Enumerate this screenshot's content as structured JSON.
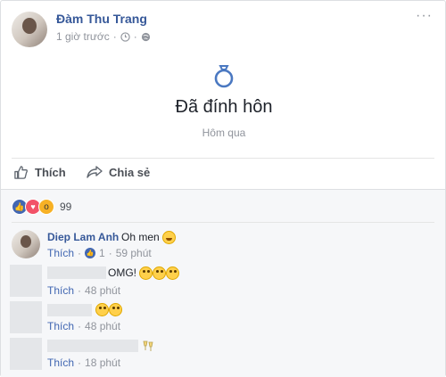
{
  "post": {
    "author": "Đàm Thu Trang",
    "time": "1 giờ trước",
    "life_event_title": "Đã đính hôn",
    "life_event_date": "Hôm qua",
    "more_label": "···"
  },
  "actions": {
    "like_label": "Thích",
    "share_label": "Chia sẻ"
  },
  "reactions": {
    "count": "99",
    "types": [
      "like-icon",
      "love-icon",
      "wow-icon"
    ]
  },
  "comments": [
    {
      "name": "Diep Lam Anh",
      "text": "Oh men",
      "emoji": "laughing-emoji",
      "like_label": "Thích",
      "reaction_count": "1",
      "time": "59 phút"
    },
    {
      "name": "",
      "text": "OMG!",
      "emoji": "flushed-emoji",
      "like_label": "Thích",
      "time": "48 phút"
    },
    {
      "name": "",
      "text": "",
      "emoji": "flushed-emoji",
      "like_label": "Thích",
      "time": "48 phút"
    },
    {
      "name": "",
      "text": "",
      "emoji": "clinking-glasses-emoji",
      "like_label": "Thích",
      "time": "18 phút"
    }
  ],
  "colors": {
    "link": "#365899",
    "meta": "#90949c",
    "like_blue": "#4267b2"
  }
}
